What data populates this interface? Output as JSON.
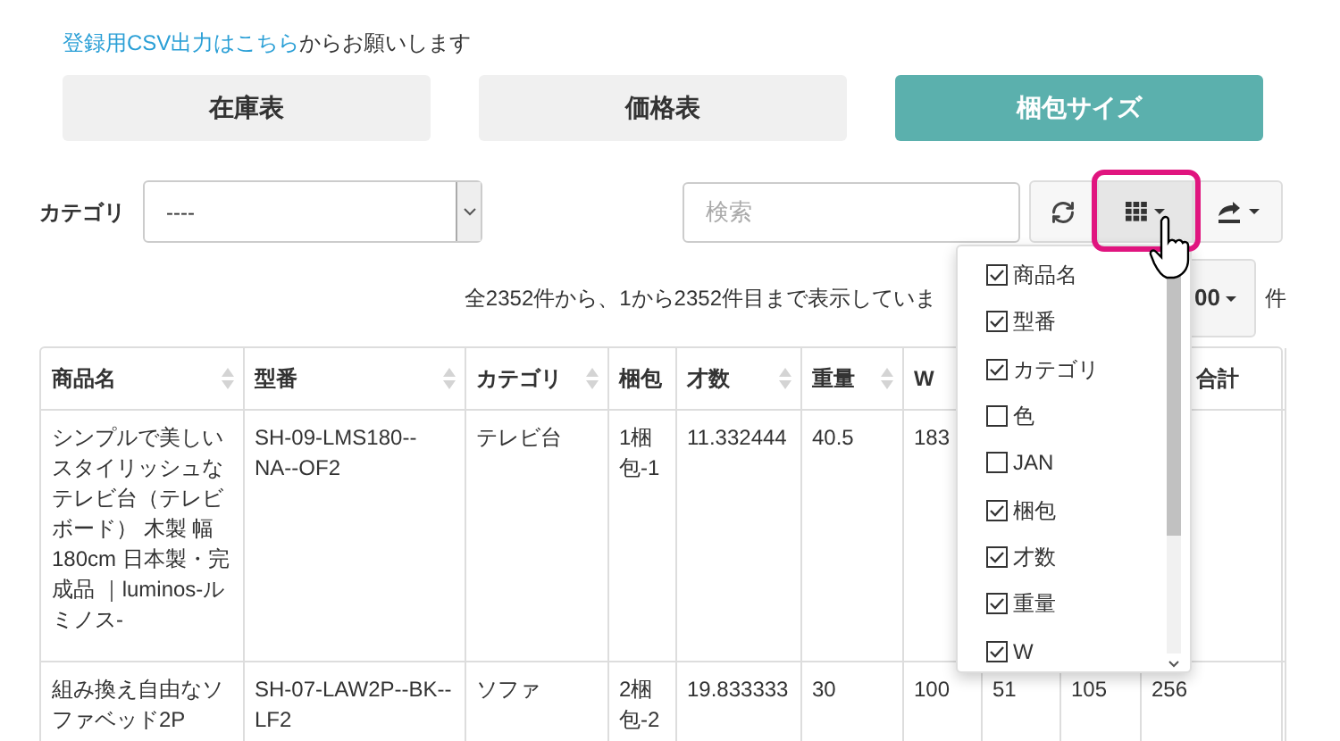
{
  "notice": {
    "link": "登録用CSV出力はこちら",
    "text": "からお願いします"
  },
  "tabs": [
    {
      "label": "在庫表",
      "selected": false
    },
    {
      "label": "価格表",
      "selected": false
    },
    {
      "label": "梱包サイズ",
      "selected": true
    }
  ],
  "filter": {
    "label": "カテゴリ",
    "value": "----"
  },
  "search": {
    "placeholder": "検索"
  },
  "columns_button": {
    "highlighted": true,
    "open": true
  },
  "summary": "全2352件から、1から2352件目まで表示していま",
  "page_size": {
    "value": "00",
    "unit": "件"
  },
  "table": {
    "columns": [
      {
        "label": "商品名",
        "sortable": true
      },
      {
        "label": "型番",
        "sortable": true
      },
      {
        "label": "カテゴリ",
        "sortable": true
      },
      {
        "label": "梱包",
        "sortable": false
      },
      {
        "label": "才数",
        "sortable": true
      },
      {
        "label": "重量",
        "sortable": true
      },
      {
        "label": "W",
        "sortable": false
      },
      {},
      {},
      {
        "label": "合計",
        "sortable": false
      }
    ],
    "rows": [
      [
        "シンプルで美しいスタイリッシュなテレビ台（テレビボード） 木製 幅180cm 日本製・完成品 ｜luminos-ルミノス-",
        "SH-09-LMS180--NA--OF2",
        "テレビ台",
        "1梱包-1",
        "11.332444",
        "40.5",
        "183",
        null,
        null,
        null
      ],
      [
        "組み換え自由なソファベッド2P",
        "SH-07-LAW2P--BK--LF2",
        "ソファ",
        "2梱包-2",
        "19.833333",
        "30",
        "100",
        "51",
        "105",
        "256"
      ]
    ]
  },
  "column_menu": [
    {
      "label": "商品名",
      "checked": true
    },
    {
      "label": "型番",
      "checked": true
    },
    {
      "label": "カテゴリ",
      "checked": true
    },
    {
      "label": "色",
      "checked": false
    },
    {
      "label": "JAN",
      "checked": false
    },
    {
      "label": "梱包",
      "checked": true
    },
    {
      "label": "才数",
      "checked": true
    },
    {
      "label": "重量",
      "checked": true
    },
    {
      "label": "W",
      "checked": true
    }
  ]
}
